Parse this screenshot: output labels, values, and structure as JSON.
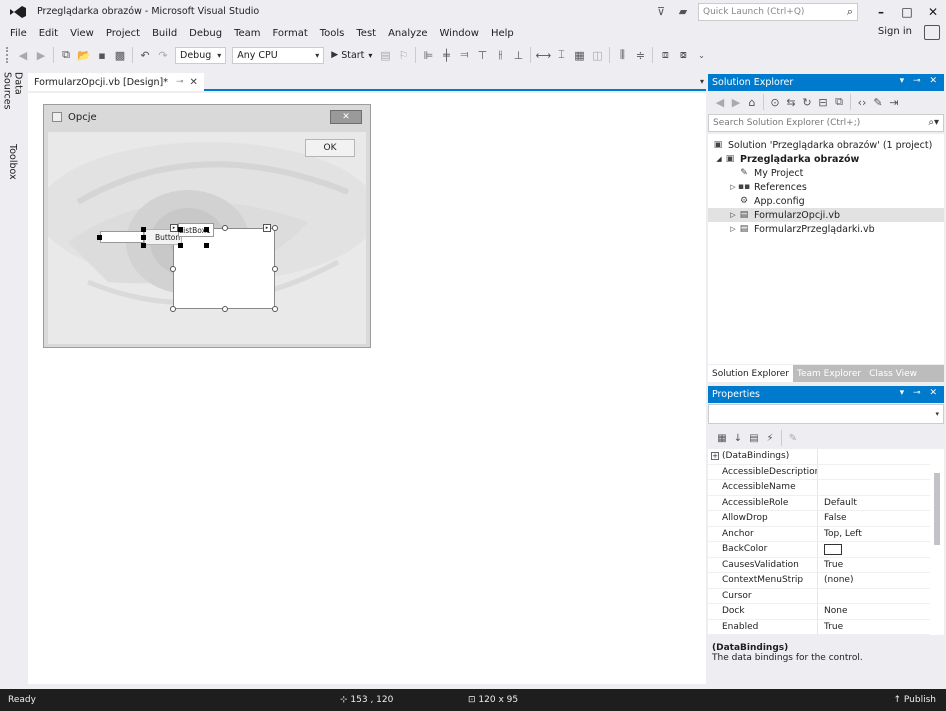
{
  "window": {
    "title": "Przeglądarka obrazów - Microsoft Visual Studio",
    "quick_launch_placeholder": "Quick Launch (Ctrl+Q)"
  },
  "menu": {
    "items": [
      "File",
      "Edit",
      "View",
      "Project",
      "Build",
      "Debug",
      "Team",
      "Format",
      "Tools",
      "Test",
      "Analyze",
      "Window",
      "Help"
    ],
    "sign_in": "Sign in"
  },
  "toolbar": {
    "configuration": "Debug",
    "platform": "Any CPU",
    "start_label": "Start"
  },
  "left_tabs": [
    "Data Sources",
    "Toolbox"
  ],
  "document": {
    "tab_label": "FormularzOpcji.vb [Design]*"
  },
  "designer_form": {
    "title": "Opcje",
    "ok_button": "OK",
    "button_label": "Button1",
    "listbox_label": "ListBox1"
  },
  "solution_explorer": {
    "header": "Solution Explorer",
    "search_placeholder": "Search Solution Explorer (Ctrl+;)",
    "tree": [
      {
        "label": "Solution 'Przeglądarka obrazów' (1 project)",
        "icon": "solution-icon"
      },
      {
        "label": "Przeglądarka obrazów",
        "icon": "vb-project-icon"
      },
      {
        "label": "My Project",
        "icon": "wrench-icon"
      },
      {
        "label": "References",
        "icon": "references-icon"
      },
      {
        "label": "App.config",
        "icon": "config-icon"
      },
      {
        "label": "FormularzOpcji.vb",
        "icon": "form-icon"
      },
      {
        "label": "FormularzPrzeglądarki.vb",
        "icon": "form-icon"
      }
    ],
    "tabs": [
      "Solution Explorer",
      "Team Explorer",
      "Class View"
    ]
  },
  "properties": {
    "header": "Properties",
    "rows": [
      {
        "name": "(DataBindings)",
        "value": ""
      },
      {
        "name": "AccessibleDescription",
        "value": ""
      },
      {
        "name": "AccessibleName",
        "value": ""
      },
      {
        "name": "AccessibleRole",
        "value": "Default"
      },
      {
        "name": "AllowDrop",
        "value": "False"
      },
      {
        "name": "Anchor",
        "value": "Top, Left"
      },
      {
        "name": "BackColor",
        "value": ""
      },
      {
        "name": "CausesValidation",
        "value": "True"
      },
      {
        "name": "ContextMenuStrip",
        "value": "(none)"
      },
      {
        "name": "Cursor",
        "value": ""
      },
      {
        "name": "Dock",
        "value": "None"
      },
      {
        "name": "Enabled",
        "value": "True"
      }
    ],
    "description_title": "(DataBindings)",
    "description_text": "The data bindings for the control."
  },
  "status": {
    "ready": "Ready",
    "position": "153 , 120",
    "size": "120 x 95",
    "publish": "Publish"
  }
}
